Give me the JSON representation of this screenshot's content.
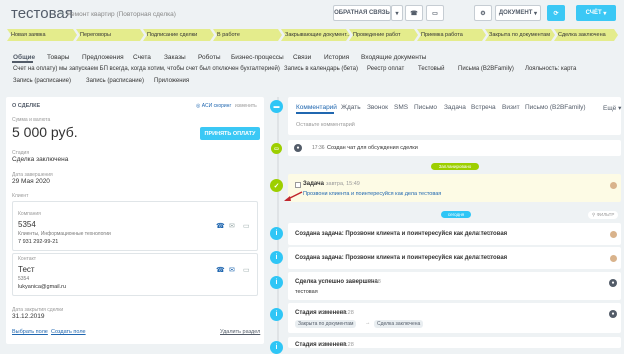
{
  "header": {
    "title": "тестовая",
    "subtitle": "Ремонт квартир (Повторная сделка)",
    "feedback": "ОБРАТНАЯ СВЯЗЬ",
    "document": "ДОКУМЕНТ",
    "account": "СЧЁТ"
  },
  "stages": [
    "Новая заявка",
    "Переговоры",
    "Подписание сделки",
    "В работе",
    "Закрывающие документ...",
    "Проведение работ",
    "Приемка работа",
    "Закрыта по документам",
    "Сделка заключена"
  ],
  "tabs_row1": [
    "Общие",
    "Товары",
    "Предложения",
    "Счета",
    "Заказы",
    "Роботы",
    "Бизнес-процессы",
    "Связи",
    "История",
    "Входящие документы"
  ],
  "tabs_row2": [
    "Счет на оплату) мы запускаем БП всегда, когда хотим, чтобы счет был отключен бухгалтерией)",
    "Запись в календарь (бета)",
    "Реестр оплат",
    "Тестовый",
    "Письма (B2BFamily)",
    "Лояльность: карта"
  ],
  "tabs_row3": [
    "Запись (расписание)",
    "Запись (расписание)",
    "Приложения"
  ],
  "left": {
    "section": "О СДЕЛКЕ",
    "ai_label": "АСИ скоринг",
    "edit": "изменить",
    "sum_label": "Сумма и валюта",
    "sum_value": "5 000 руб.",
    "pay_button": "ПРИНЯТЬ ОПЛАТУ",
    "stage_label": "Стадия",
    "stage_value": "Сделка заключена",
    "date_label": "Дата завершения",
    "date_value": "29 Мая 2020",
    "client_label": "Клиент",
    "company_label": "Компания",
    "company_name": "5354",
    "company_type": "Клиенты, Информационные технологии",
    "company_phone": "7 931 292-99-21",
    "contact_label": "Контакт",
    "contact_name": "Тест",
    "contact_id": "5354",
    "contact_email": "lukyanica@gmail.ru",
    "close_label": "Дата закрытия сделки",
    "close_value": "31.12.2019",
    "select_field": "Выбрать поле",
    "create_field": "Создать поле",
    "delete_section": "Удалить раздел"
  },
  "feed": {
    "tabs": [
      "Комментарий",
      "Ждать",
      "Звонок",
      "SMS",
      "Письмо",
      "Задача",
      "Встреча",
      "Визит",
      "Письмо (B2BFamily)",
      "Ещё"
    ],
    "comment_placeholder": "Оставьте комментарий",
    "chat_time": "17:36",
    "chat_text": "Создан чат для обсуждения сделки",
    "planned_label": "Запланировано",
    "task_title": "Задача",
    "task_time": "завтра, 15:49",
    "task_text": "Прозвони клиента и поинтересуйся как дела тестовая",
    "today_label": "сегодня",
    "filter_label": "ФИЛЬТР",
    "items": [
      {
        "text": "Создана задача: Прозвони клиента и поинтересуйся как дела тестовая",
        "time": "15:49"
      },
      {
        "text": "Создана задача: Прозвони клиента и поинтересуйся как дела тестовая",
        "time": "15:49"
      },
      {
        "text": "Сделка успешно завершена",
        "time": "15:28",
        "sub": "тестовая"
      },
      {
        "text": "Стадия изменена",
        "time": "15:28",
        "from": "Закрыта по документам",
        "to": "Сделка заключена"
      },
      {
        "text": "Стадия изменена",
        "time": "15:28"
      }
    ]
  },
  "colors": {
    "accent": "#3bc8f5",
    "stage": "#e4ec8c",
    "green": "#9dcf00",
    "blue": "#2fc6f6"
  }
}
